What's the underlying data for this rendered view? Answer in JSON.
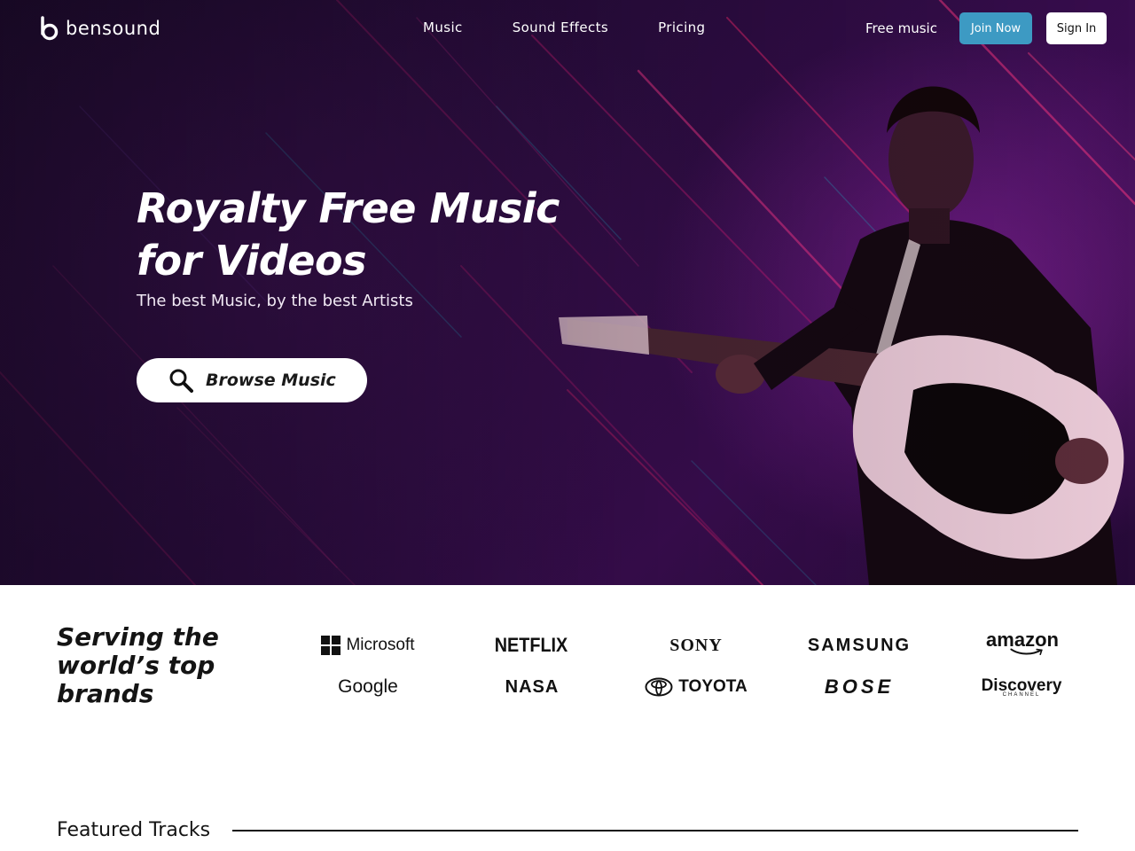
{
  "nav": {
    "logo_text": "bensound",
    "links": [
      "Music",
      "Sound Effects",
      "Pricing"
    ],
    "free_music": "Free music",
    "join_label": "Join Now",
    "signin_label": "Sign In"
  },
  "hero": {
    "title_line1": "Royalty Free Music",
    "title_line2": "for Videos",
    "subtitle": "The best Music, by the best Artists",
    "browse_label": "Browse Music"
  },
  "brands": {
    "title_line1": "Serving the",
    "title_line2": "world’s top",
    "title_line3": "brands",
    "logos": {
      "microsoft": "Microsoft",
      "netflix": "NETFLIX",
      "sony": "SONY",
      "samsung": "SAMSUNG",
      "amazon": "amazon",
      "google": "Google",
      "nasa": "NASA",
      "toyota": "TOYOTA",
      "bose": "BOSE",
      "discovery": "Discovery",
      "discovery_sub": "CHANNEL"
    }
  },
  "featured": {
    "title": "Featured Tracks"
  },
  "colors": {
    "join_button": "#3d9ac3",
    "hero_background": "#2a0c3e",
    "streak_pink": "#e0207a",
    "streak_teal": "#2aa0c0"
  }
}
